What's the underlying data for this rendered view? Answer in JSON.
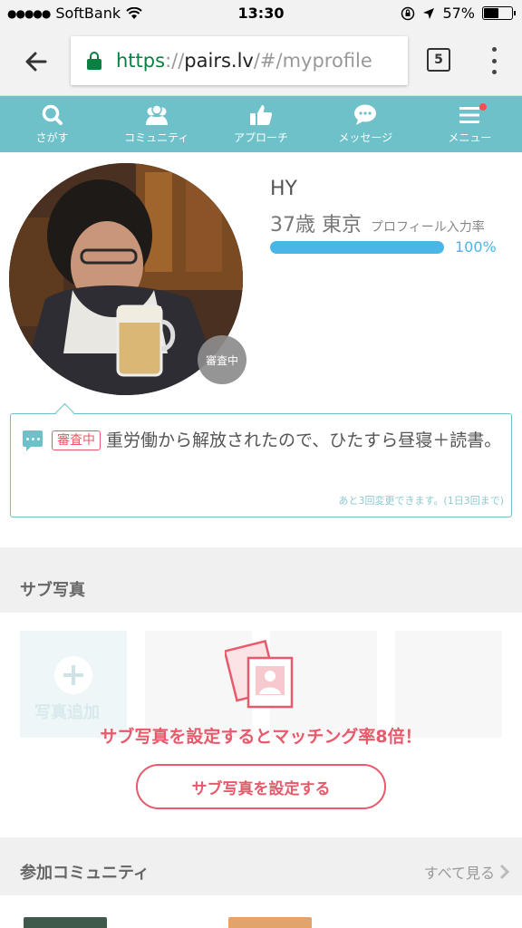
{
  "status_bar": {
    "carrier": "SoftBank",
    "time": "13:30",
    "battery": "57%",
    "battery_level": 0.57
  },
  "browser": {
    "url_scheme": "https",
    "url_sep": "://",
    "url_domain": "pairs.lv",
    "url_path": "/#/myprofile",
    "tab_count": "5"
  },
  "nav": {
    "items": [
      {
        "label": "さがす",
        "icon": "search-icon"
      },
      {
        "label": "コミュニティ",
        "icon": "community-icon"
      },
      {
        "label": "アプローチ",
        "icon": "thumbs-up-icon"
      },
      {
        "label": "メッセージ",
        "icon": "message-icon"
      },
      {
        "label": "メニュー",
        "icon": "menu-icon",
        "has_notification": true
      }
    ]
  },
  "profile": {
    "name": "HY",
    "age_city": "37歳 東京",
    "completion_label": "プロフィール入力率",
    "completion_value": "100%",
    "completion_fraction": 1.0,
    "photo_status": "審査中"
  },
  "tweet": {
    "status": "審査中",
    "text": "重労働から解放されたので、ひたすら昼寝＋読書。",
    "note": "あと3回変更できます。(1日3回まで)"
  },
  "sub_photos": {
    "title": "サブ写真",
    "add_label": "写真追加",
    "promo": "サブ写真を設定するとマッチング率8倍！",
    "button": "サブ写真を設定する"
  },
  "communities": {
    "title": "参加コミュニティ",
    "see_all": "すべて見る"
  },
  "colors": {
    "accent": "#6ec1c8",
    "progress": "#4ab6e8",
    "warning": "#e85a6b"
  }
}
